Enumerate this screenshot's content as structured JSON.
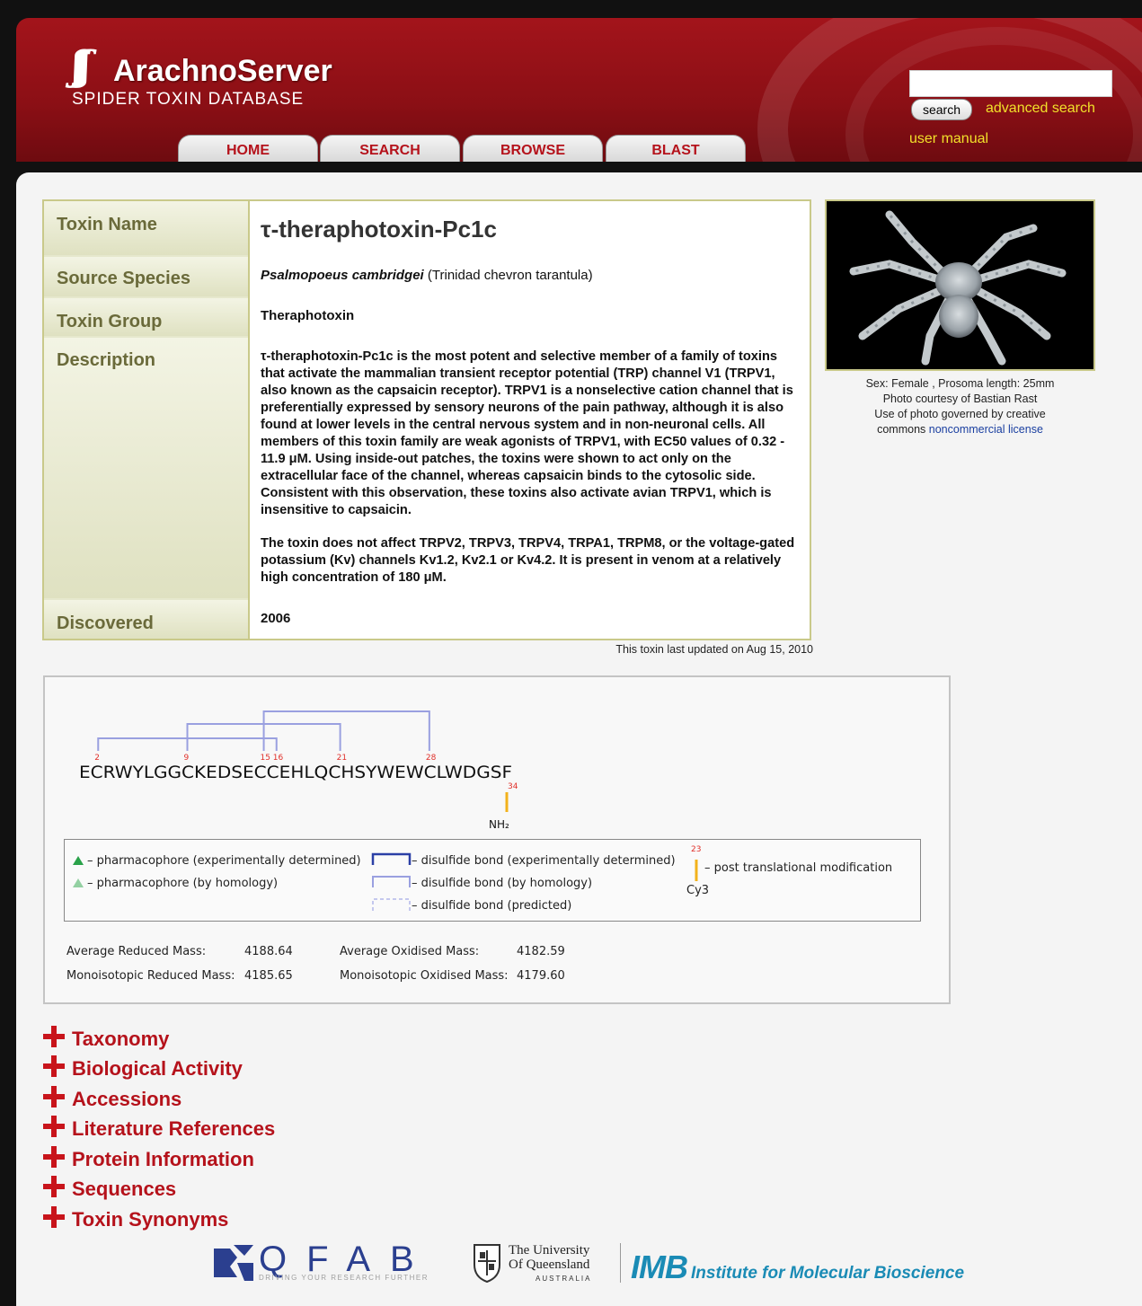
{
  "header": {
    "logo_title": "ArachnoServer",
    "logo_subtitle": "SPIDER TOXIN DATABASE",
    "tabs": [
      "HOME",
      "SEARCH",
      "BROWSE",
      "BLAST"
    ],
    "search_value": "",
    "search_button": "search",
    "advanced_search": "advanced search",
    "user_manual": "user manual"
  },
  "toxin": {
    "labels": {
      "name": "Toxin Name",
      "species": "Source Species",
      "group": "Toxin Group",
      "description": "Description",
      "discovered": "Discovered"
    },
    "name": "τ-theraphotoxin-Pc1c",
    "species_scientific": "Psalmopoeus  cambridgei",
    "species_common": "(Trinidad chevron tarantula)",
    "group": "Theraphotoxin",
    "description_p1": "τ-theraphotoxin-Pc1c is the most potent and selective member of a family of toxins that activate the mammalian transient receptor potential (TRP) channel V1 (TRPV1, also known as the capsaicin receptor). TRPV1 is a nonselective cation channel that is preferentially expressed by sensory neurons of the pain pathway, although it is also found at lower levels in the central nervous system and in non-neuronal cells. All members of this toxin family are weak agonists of TRPV1, with EC50 values of 0.32 - 11.9 μM. Using inside-out patches, the toxins were shown to act only on the extracellular face of the channel, whereas capsaicin binds to the cytosolic side. Consistent with this observation, these toxins also activate avian TRPV1, which is insensitive to capsaicin.",
    "description_p2": "The toxin does not affect TRPV2, TRPV3, TRPV4, TRPA1, TRPM8, or the voltage-gated potassium (Kv) channels Kv1.2, Kv2.1 or Kv4.2. It is present in venom at a relatively high concentration of 180 μM.",
    "discovered": "2006",
    "last_updated": "This toxin last updated on Aug 15, 2010"
  },
  "photo": {
    "caption_line1": "Sex: Female , Prosoma length: 25mm",
    "caption_line2": "Photo courtesy of Bastian Rast",
    "caption_line3": "Use of photo governed by creative",
    "caption_line4_text": "commons",
    "caption_line4_link": "noncommercial license"
  },
  "sequence": {
    "residues": "ECRWYLGGCKEDSECCEHLQCHSYWEWCLWDGSF",
    "cysteine_positions": [
      "2",
      "9",
      "15",
      "16",
      "21",
      "28"
    ],
    "modification_position": "34",
    "modification_label": "NH₂",
    "legend": {
      "pharm_exp": "– pharmacophore (experimentally determined)",
      "pharm_hom": "– pharmacophore (by homology)",
      "ss_exp": "– disulfide bond (experimentally determined)",
      "ss_hom": "– disulfide bond (by homology)",
      "ss_pred": "– disulfide bond (predicted)",
      "ptm_number": "23",
      "ptm_label": "– post translational modification",
      "ptm_example": "Cy3"
    },
    "masses": {
      "avg_reduced_label": "Average Reduced Mass:",
      "avg_reduced_value": "4188.64",
      "mono_reduced_label": "Monoisotopic Reduced Mass:",
      "mono_reduced_value": "4185.65",
      "avg_oxidised_label": "Average Oxidised Mass:",
      "avg_oxidised_value": "4182.59",
      "mono_oxidised_label": "Monoisotopic Oxidised Mass:",
      "mono_oxidised_value": "4179.60"
    }
  },
  "sections": [
    "Taxonomy",
    "Biological Activity",
    "Accessions",
    "Literature References",
    "Protein Information",
    "Sequences",
    "Toxin Synonyms"
  ],
  "footer": {
    "qfab": "QFAB",
    "qfab_tagline": "DRIVING YOUR RESEARCH FURTHER",
    "uq_line1": "The University",
    "uq_line2": "Of Queensland",
    "uq_line3": "AUSTRALIA",
    "imb_mark": "IMB",
    "imb_name": "Institute for Molecular Bioscience"
  },
  "colors": {
    "brand_red": "#b5121b",
    "link_yellow": "#f1e02a",
    "label_olive": "#6a6a3a",
    "bond_blue": "#9aa0e0",
    "ptm_orange": "#f2b21b",
    "pharm_green": "#2aa24a"
  }
}
